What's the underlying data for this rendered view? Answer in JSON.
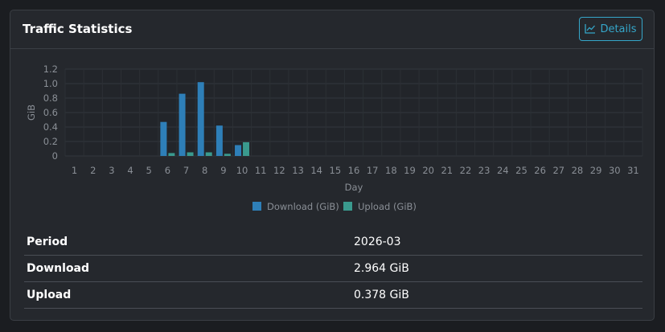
{
  "card": {
    "title": "Traffic Statistics",
    "details_label": "Details"
  },
  "colors": {
    "download": "#2e7fb8",
    "upload": "#3a9a8e",
    "accent": "#35a6c9"
  },
  "chart_data": {
    "type": "bar",
    "categories": [
      "1",
      "2",
      "3",
      "4",
      "5",
      "6",
      "7",
      "8",
      "9",
      "10",
      "11",
      "12",
      "13",
      "14",
      "15",
      "16",
      "17",
      "18",
      "19",
      "20",
      "21",
      "22",
      "23",
      "24",
      "25",
      "26",
      "27",
      "28",
      "29",
      "30",
      "31"
    ],
    "series": [
      {
        "name": "Download (GiB)",
        "values": [
          0,
          0,
          0,
          0,
          0,
          0.47,
          0.86,
          1.02,
          0.42,
          0.15,
          0,
          0,
          0,
          0,
          0,
          0,
          0,
          0,
          0,
          0,
          0,
          0,
          0,
          0,
          0,
          0,
          0,
          0,
          0,
          0,
          0
        ]
      },
      {
        "name": "Upload (GiB)",
        "values": [
          0,
          0,
          0,
          0,
          0,
          0.04,
          0.05,
          0.05,
          0.03,
          0.19,
          0,
          0,
          0,
          0,
          0,
          0,
          0,
          0,
          0,
          0,
          0,
          0,
          0,
          0,
          0,
          0,
          0,
          0,
          0,
          0,
          0
        ]
      }
    ],
    "xlabel": "Day",
    "ylabel": "GiB",
    "y_ticks": [
      "0",
      "0.2",
      "0.4",
      "0.6",
      "0.8",
      "1.0",
      "1.2"
    ],
    "ylim": [
      0,
      1.2
    ],
    "grid": true,
    "legend_position": "bottom"
  },
  "stats": [
    {
      "label": "Period",
      "value": "2026-03"
    },
    {
      "label": "Download",
      "value": "2.964 GiB"
    },
    {
      "label": "Upload",
      "value": "0.378 GiB"
    }
  ]
}
